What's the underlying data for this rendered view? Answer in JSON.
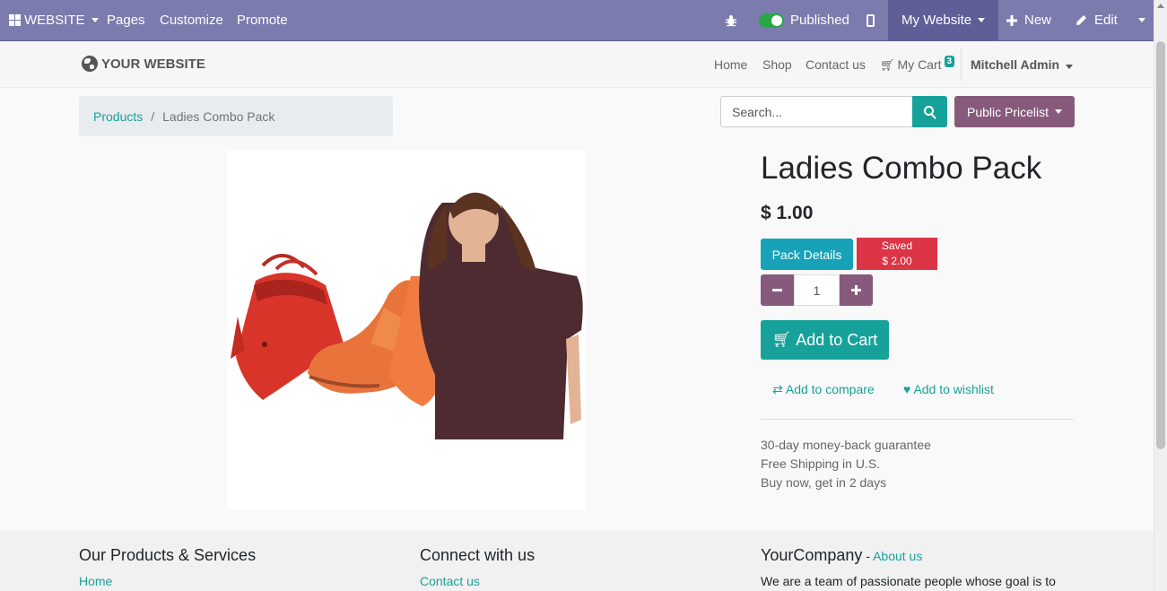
{
  "admin_bar": {
    "website_menu": "WEBSITE",
    "pages": "Pages",
    "customize": "Customize",
    "promote": "Promote",
    "published": "Published",
    "my_website": "My Website",
    "new": "New",
    "edit": "Edit"
  },
  "site_header": {
    "logo_text": "YOUR WEBSITE",
    "nav": [
      "Home",
      "Shop",
      "Contact us"
    ],
    "cart_label": "My Cart",
    "cart_count": "3",
    "user": "Mitchell Admin"
  },
  "breadcrumb": {
    "parent": "Products",
    "separator": "/",
    "current": "Ladies Combo Pack"
  },
  "search": {
    "placeholder": "Search..."
  },
  "pricelist": "Public Pricelist",
  "product": {
    "title": "Ladies Combo Pack",
    "price": "$ 1.00",
    "pack_details": "Pack Details",
    "saved_label": "Saved",
    "saved_amount": "$ 2.00",
    "quantity": "1",
    "add_to_cart": "Add to Cart",
    "add_to_compare": "Add to compare",
    "add_to_wishlist": "Add to wishlist",
    "info": [
      "30-day money-back guarantee",
      "Free Shipping in U.S.",
      "Buy now, get in 2 days"
    ]
  },
  "footer": {
    "col1_title": "Our Products & Services",
    "col1_link": "Home",
    "col2_title": "Connect with us",
    "col2_link": "Contact us",
    "col3_title": "YourCompany",
    "col3_dash": " - ",
    "col3_link": "About us",
    "col3_text": "We are a team of passionate people whose goal is to"
  },
  "colors": {
    "admin_bar": "#7c7bad",
    "primary_teal": "#16a29a",
    "odoo_purple": "#875a7b",
    "danger_red": "#dc3545",
    "info_cyan": "#17a2b8"
  },
  "icons": [
    "apps-grid-icon",
    "bug-icon",
    "mobile-icon",
    "plus-icon",
    "pencil-icon",
    "globe-icon",
    "cart-icon",
    "search-icon",
    "minus-icon",
    "exchange-icon",
    "heart-icon"
  ]
}
